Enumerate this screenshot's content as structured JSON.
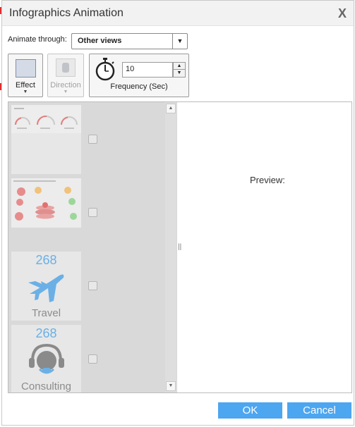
{
  "dialog": {
    "title": "Infographics Animation",
    "close_glyph": "X"
  },
  "animate": {
    "label": "Animate through:",
    "selected": "Other views"
  },
  "toolbar": {
    "effect_label": "Effect",
    "direction_label": "Direction",
    "frequency_value": "10",
    "frequency_label": "Frequency (Sec)"
  },
  "list": {
    "items": [
      {
        "thumb_type": "gauges"
      },
      {
        "thumb_type": "bubbles"
      },
      {
        "thumb_type": "icon",
        "number": "268",
        "caption": "Travel",
        "icon": "airplane-icon"
      },
      {
        "thumb_type": "icon",
        "number": "268",
        "caption": "Consulting",
        "icon": "headset-icon"
      }
    ]
  },
  "preview": {
    "label": "Preview:"
  },
  "footer": {
    "ok_label": "OK",
    "cancel_label": "Cancel"
  },
  "colors": {
    "accent": "#4da6f0",
    "list_bg": "#d9d9d9"
  }
}
